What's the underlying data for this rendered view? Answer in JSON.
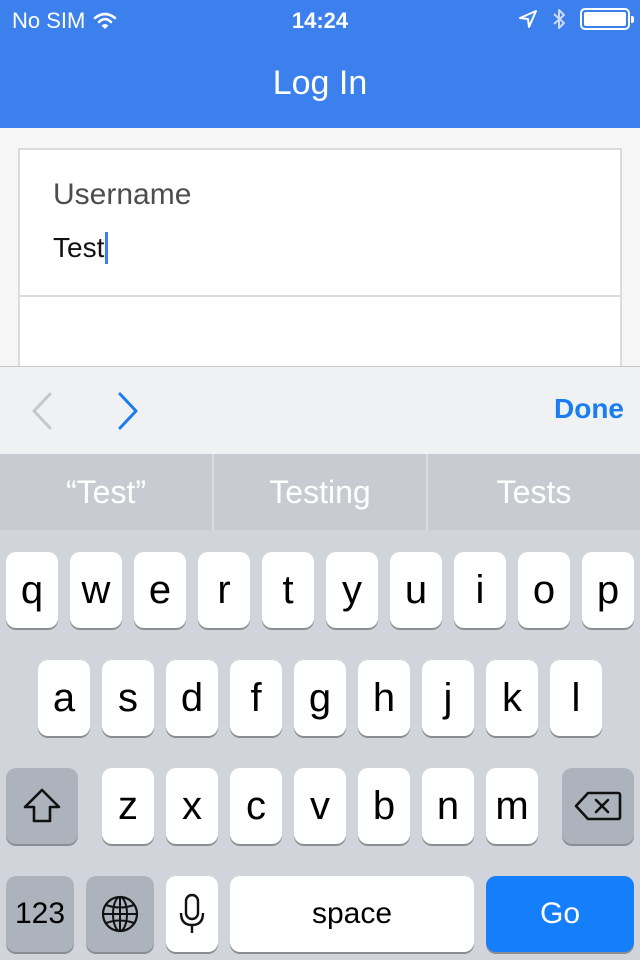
{
  "status_bar": {
    "carrier": "No SIM",
    "time": "14:24",
    "battery_level": 1.0
  },
  "nav": {
    "title": "Log In"
  },
  "form": {
    "username_label": "Username",
    "username_value": "Test"
  },
  "accessory": {
    "prev_icon": "chevron-left-icon",
    "next_icon": "chevron-right-icon",
    "done_label": "Done"
  },
  "suggestions": [
    "“Test”",
    "Testing",
    "Tests"
  ],
  "keyboard": {
    "row1": [
      "q",
      "w",
      "e",
      "r",
      "t",
      "y",
      "u",
      "i",
      "o",
      "p"
    ],
    "row2": [
      "a",
      "s",
      "d",
      "f",
      "g",
      "h",
      "j",
      "k",
      "l"
    ],
    "row3": [
      "z",
      "x",
      "c",
      "v",
      "b",
      "n",
      "m"
    ],
    "numbers_label": "123",
    "space_label": "space",
    "go_label": "Go",
    "icons": [
      "shift-icon",
      "backspace-icon",
      "globe-icon",
      "microphone-icon"
    ]
  },
  "colors": {
    "nav_bar": "#3b80ec",
    "accent": "#1a7ef0",
    "go_key": "#157efb"
  }
}
